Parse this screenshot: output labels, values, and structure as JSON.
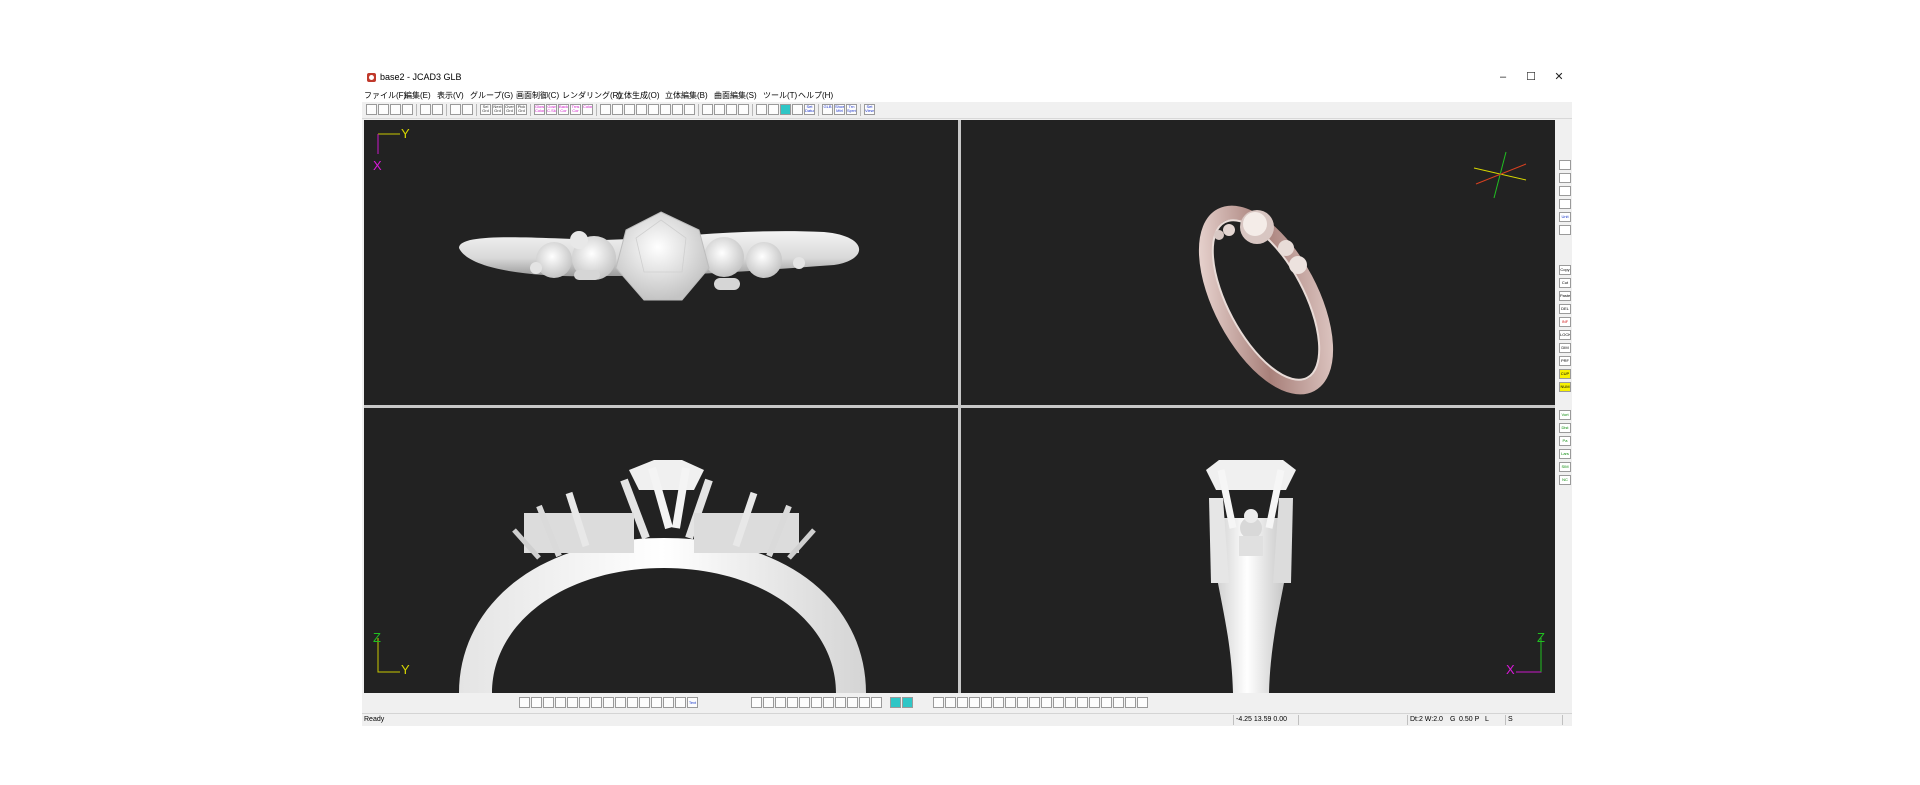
{
  "window": {
    "title": "base2 - JCAD3 GLB",
    "minimize_glyph": "–",
    "maximize_glyph": "☐",
    "close_glyph": "✕"
  },
  "menu": [
    "ファイル(F)",
    "編集(E)",
    "表示(V)",
    "グループ(G)",
    "画面制御(C)",
    "レンダリング(R)",
    "立体生成(O)",
    "立体編集(B)",
    "曲面編集(S)",
    "ツール(T)",
    "ヘルプ(H)"
  ],
  "toolbar": {
    "file_icons": [
      "new-file-icon",
      "open-folder-icon",
      "save-icon",
      "print-icon",
      "undo-icon",
      "redo-icon"
    ],
    "view_icons": [
      "copy-view-icon",
      "split-view-icon"
    ],
    "grid_buttons": [
      "Sel Grd",
      "Next Grd",
      "Over Grd",
      "Pick Grd"
    ],
    "color_buttons": [
      "Glow ColorE",
      "Gow C.Sk",
      "Back Cor",
      "Trns Cor",
      "Color"
    ],
    "zoom_icons": [
      "zoom-in-icon",
      "zoom-out-icon",
      "zoom-window-icon",
      "zoom-fit-icon",
      "zoom-all-icon",
      "pan-icon",
      "zoom-prev-icon",
      "pan-view-icon"
    ],
    "render_icons": [
      "rotate-icon",
      "rotate-reset-icon",
      "search-icon",
      "frame-icon"
    ],
    "misc_icons": [
      "grid-icon",
      "dot-grid-icon",
      "cyan-view-icon",
      "blank-icon"
    ],
    "text_buttons": [
      "Set Datum",
      "GLB",
      "Show Mtrl",
      "Trn Sprnt",
      "Set Views"
    ]
  },
  "viewports": {
    "top": {
      "axis_v": "Y",
      "axis_h": "X"
    },
    "side": {
      "axis_v": "Z",
      "axis_h": "Y"
    },
    "front": {
      "axis_v": "Z",
      "axis_h": "X"
    }
  },
  "sidebar": {
    "view_icons": [
      "view-camera-icon",
      "view-top-icon",
      "view-persp-icon",
      "view-rotate-icon",
      "Unit",
      "view-reset-icon"
    ],
    "edit_buttons": [
      "Copy",
      "Cut",
      "Paste",
      "DEL",
      "INF",
      "LOCK",
      "DIM",
      "PRF",
      "CUP",
      "NUM"
    ],
    "gen_buttons": [
      "Vort ation",
      "Dist ation",
      "Pa rts",
      "Lars pos",
      "SIM",
      "NC Data"
    ]
  },
  "bottombar": {
    "create_icons": [
      "curve-icon",
      "spline-icon",
      "polyline-icon",
      "arc-icon",
      "line-icon",
      "offset-icon",
      "join-icon",
      "trim-icon",
      "rect-icon",
      "circle-icon",
      "cube-icon",
      "cut-icon",
      "mirror-icon",
      "array-icon",
      "Text"
    ],
    "edit_icons": [
      "select-icon",
      "move-icon",
      "rotate-obj-icon",
      "scale-icon",
      "shell-icon",
      "fillet-icon",
      "boolean-icon",
      "measure-icon",
      "pick-icon",
      "person-icon",
      "lathe-icon"
    ],
    "color_icons": [
      "layer-a-icon",
      "layer-b-icon"
    ],
    "surface_icons": [
      "crosshair-icon",
      "extrude-icon",
      "loft-icon",
      "sweep-icon",
      "blend-icon",
      "revolve-icon",
      "patch-icon",
      "split-icon",
      "trim-surf-icon",
      "stitch-icon",
      "unfold-icon",
      "check-icon",
      "rebuild-icon",
      "cap-icon",
      "flip-icon",
      "paint-icon",
      "box-icon",
      "eye-icon"
    ]
  },
  "status": {
    "left": "Ready",
    "coords": "-4.25 13.59 0.00",
    "settings": "Dt:2 W:2.0",
    "grid": "G",
    "pitch": "0.50 P",
    "layer": "L",
    "snap": "S"
  }
}
